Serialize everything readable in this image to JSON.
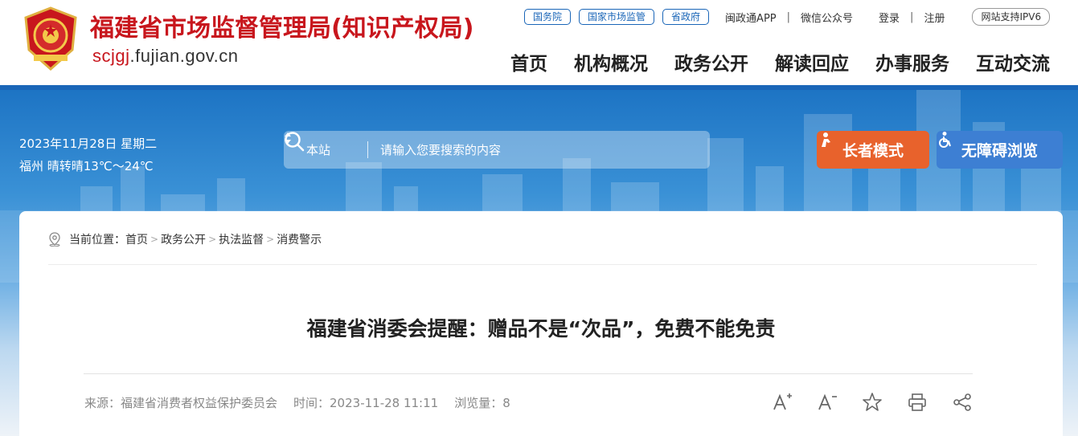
{
  "header": {
    "site_title": "福建省市场监督管理局(知识产权局)",
    "domain_part1": "scjgj",
    "domain_part2": ".fujian.gov.cn",
    "top_tags": [
      "国务院",
      "国家市场监管",
      "省政府"
    ],
    "app_link": "闽政通APP",
    "wechat_link": "微信公众号",
    "login": "登录",
    "register": "注册",
    "ipv6_badge": "网站支持IPV6",
    "nav": [
      "首页",
      "机构概况",
      "政务公开",
      "解读回应",
      "办事服务",
      "互动交流"
    ],
    "brand_red": "#c8161d",
    "brand_blue": "#1a66b8"
  },
  "banner": {
    "date": "2023年11月28日 星期二",
    "weather": "福州 晴转晴13℃～24℃",
    "search_scope": "本站",
    "search_placeholder": "请输入您要搜索的内容",
    "elder_mode": "长者模式",
    "accessible": "无障碍浏览",
    "elder_color": "#e8622c",
    "access_color": "#3d7fd3"
  },
  "breadcrumb": {
    "prefix": "当前位置：",
    "items": [
      "首页",
      "政务公开",
      "执法监督",
      "消费警示"
    ]
  },
  "article": {
    "title": "福建省消委会提醒：赠品不是“次品”，免费不能免责",
    "source": "来源：福建省消费者权益保护委员会",
    "time": "时间：2023-11-28 11:11",
    "views": "浏览量：8"
  },
  "tools": [
    "font-increase-icon",
    "font-decrease-icon",
    "favorite-star-icon",
    "print-icon",
    "share-icon"
  ]
}
